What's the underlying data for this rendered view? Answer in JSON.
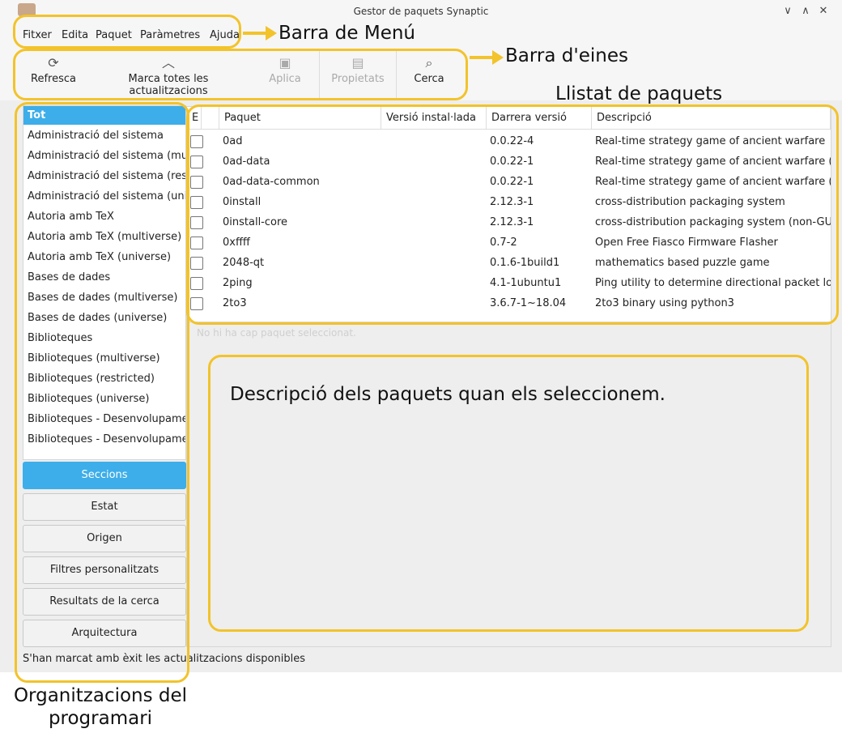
{
  "window": {
    "title": "Gestor de paquets Synaptic",
    "controls": {
      "minimize": "∨",
      "maximize": "∧",
      "close": "✕"
    }
  },
  "menu": [
    "Fitxer",
    "Edita",
    "Paquet",
    "Paràmetres",
    "Ajuda"
  ],
  "toolbar": {
    "refresh": {
      "label": "Refresca",
      "icon": "refresh-icon"
    },
    "mark_all": {
      "label": "Marca totes les actualitzacions",
      "icon": "chevron-up-icon"
    },
    "apply": {
      "label": "Aplica",
      "icon": "apply-icon"
    },
    "properties": {
      "label": "Propietats",
      "icon": "properties-icon"
    },
    "search": {
      "label": "Cerca",
      "icon": "search-icon"
    }
  },
  "sections": [
    "Tot",
    "Administració del sistema",
    "Administració del sistema (multiverse)",
    "Administració del sistema (restricted)",
    "Administració del sistema (universe)",
    "Autoria amb TeX",
    "Autoria amb TeX (multiverse)",
    "Autoria amb TeX (universe)",
    "Bases de dades",
    "Bases de dades (multiverse)",
    "Bases de dades (universe)",
    "Biblioteques",
    "Biblioteques (multiverse)",
    "Biblioteques (restricted)",
    "Biblioteques (universe)",
    "Biblioteques - Desenvolupament",
    "Biblioteques - Desenvolupament"
  ],
  "filter_buttons": [
    "Seccions",
    "Estat",
    "Origen",
    "Filtres personalitzats",
    "Resultats de la cerca",
    "Arquitectura"
  ],
  "table": {
    "headers": [
      "E",
      "",
      "Paquet",
      "Versió instal·lada",
      "Darrera versió",
      "Descripció"
    ],
    "rows": [
      {
        "package": "0ad",
        "installed": "",
        "latest": "0.0.22-4",
        "description": "Real-time strategy game of ancient warfare"
      },
      {
        "package": "0ad-data",
        "installed": "",
        "latest": "0.0.22-1",
        "description": "Real-time strategy game of ancient warfare (data files)"
      },
      {
        "package": "0ad-data-common",
        "installed": "",
        "latest": "0.0.22-1",
        "description": "Real-time strategy game of ancient warfare (common data files)"
      },
      {
        "package": "0install",
        "installed": "",
        "latest": "2.12.3-1",
        "description": "cross-distribution packaging system"
      },
      {
        "package": "0install-core",
        "installed": "",
        "latest": "2.12.3-1",
        "description": "cross-distribution packaging system (non-GUI parts)"
      },
      {
        "package": "0xffff",
        "installed": "",
        "latest": "0.7-2",
        "description": "Open Free Fiasco Firmware Flasher"
      },
      {
        "package": "2048-qt",
        "installed": "",
        "latest": "0.1.6-1build1",
        "description": "mathematics based puzzle game"
      },
      {
        "package": "2ping",
        "installed": "",
        "latest": "4.1-1ubuntu1",
        "description": "Ping utility to determine directional packet loss"
      },
      {
        "package": "2to3",
        "installed": "",
        "latest": "3.6.7-1~18.04",
        "description": "2to3 binary using python3"
      }
    ]
  },
  "description_pane": {
    "placeholder": "No hi ha cap paquet seleccionat."
  },
  "status_bar": "S'han marcat amb èxit les actualitzacions disponibles",
  "annotations": {
    "menu_bar": "Barra de Menú",
    "toolbar": "Barra d'eines",
    "package_list": "Llistat de paquets",
    "description": "Descripció dels paquets quan els seleccionem.",
    "organizations_line1": "Organitzacions del",
    "organizations_line2": "programari"
  },
  "colors": {
    "accent": "#3daee9",
    "annotation": "#f2c32b"
  }
}
